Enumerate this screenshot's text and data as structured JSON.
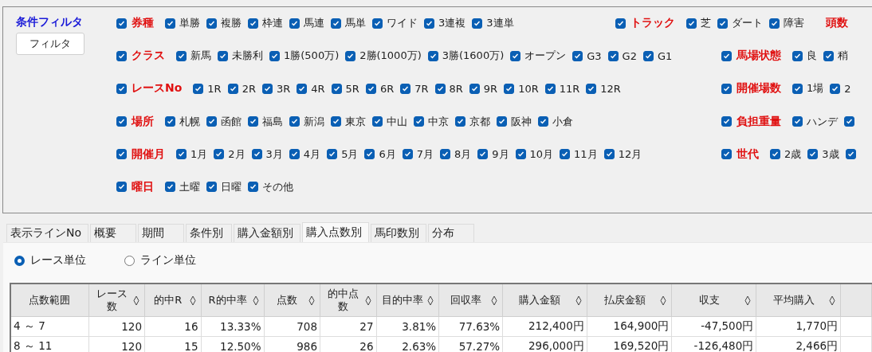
{
  "filter_panel": {
    "title": "条件フィルタ",
    "button": "フィルタ",
    "rows": [
      [
        {
          "label": "券種",
          "checked": true,
          "items": [
            {
              "label": "単勝",
              "checked": true
            },
            {
              "label": "複勝",
              "checked": true
            },
            {
              "label": "枠連",
              "checked": true
            },
            {
              "label": "馬連",
              "checked": true
            },
            {
              "label": "馬単",
              "checked": true
            },
            {
              "label": "ワイド",
              "checked": true
            },
            {
              "label": "3連複",
              "checked": true
            },
            {
              "label": "3連単",
              "checked": true
            }
          ]
        },
        {
          "label": "トラック",
          "checked": true,
          "items": [
            {
              "label": "芝",
              "checked": true
            },
            {
              "label": "ダート",
              "checked": true
            },
            {
              "label": "障害",
              "checked": true
            }
          ]
        },
        {
          "label": "頭数"
        }
      ],
      [
        {
          "label": "クラス",
          "checked": true,
          "items": [
            {
              "label": "新馬",
              "checked": true
            },
            {
              "label": "未勝利",
              "checked": true
            },
            {
              "label": "1勝(500万)",
              "checked": true
            },
            {
              "label": "2勝(1000万)",
              "checked": true
            },
            {
              "label": "3勝(1600万)",
              "checked": true
            },
            {
              "label": "オープン",
              "checked": true
            },
            {
              "label": "G3",
              "checked": true
            },
            {
              "label": "G2",
              "checked": true
            },
            {
              "label": "G1",
              "checked": true
            }
          ]
        },
        {
          "label": "馬場状態",
          "checked": true,
          "items": [
            {
              "label": "良",
              "checked": true
            },
            {
              "label": "稍",
              "checked": true
            }
          ]
        }
      ],
      [
        {
          "label": "レースNo",
          "checked": true,
          "items": [
            {
              "label": "1R",
              "checked": true
            },
            {
              "label": "2R",
              "checked": true
            },
            {
              "label": "3R",
              "checked": true
            },
            {
              "label": "4R",
              "checked": true
            },
            {
              "label": "5R",
              "checked": true
            },
            {
              "label": "6R",
              "checked": true
            },
            {
              "label": "7R",
              "checked": true
            },
            {
              "label": "8R",
              "checked": true
            },
            {
              "label": "9R",
              "checked": true
            },
            {
              "label": "10R",
              "checked": true
            },
            {
              "label": "11R",
              "checked": true
            },
            {
              "label": "12R",
              "checked": true
            }
          ]
        },
        {
          "label": "開催場数",
          "checked": true,
          "items": [
            {
              "label": "1場",
              "checked": true
            },
            {
              "label": "2",
              "checked": true
            }
          ]
        }
      ],
      [
        {
          "label": "場所",
          "checked": true,
          "items": [
            {
              "label": "札幌",
              "checked": true
            },
            {
              "label": "函館",
              "checked": true
            },
            {
              "label": "福島",
              "checked": true
            },
            {
              "label": "新潟",
              "checked": true
            },
            {
              "label": "東京",
              "checked": true
            },
            {
              "label": "中山",
              "checked": true
            },
            {
              "label": "中京",
              "checked": true
            },
            {
              "label": "京都",
              "checked": true
            },
            {
              "label": "阪神",
              "checked": true
            },
            {
              "label": "小倉",
              "checked": true
            }
          ]
        },
        {
          "label": "負担重量",
          "checked": true,
          "items": [
            {
              "label": "ハンデ",
              "checked": true
            },
            {
              "checked": true
            }
          ]
        }
      ],
      [
        {
          "label": "開催月",
          "checked": true,
          "items": [
            {
              "label": "1月",
              "checked": true
            },
            {
              "label": "2月",
              "checked": true
            },
            {
              "label": "3月",
              "checked": true
            },
            {
              "label": "4月",
              "checked": true
            },
            {
              "label": "5月",
              "checked": true
            },
            {
              "label": "6月",
              "checked": true
            },
            {
              "label": "7月",
              "checked": true
            },
            {
              "label": "8月",
              "checked": true
            },
            {
              "label": "9月",
              "checked": true
            },
            {
              "label": "10月",
              "checked": true
            },
            {
              "label": "11月",
              "checked": true
            },
            {
              "label": "12月",
              "checked": true
            }
          ]
        },
        {
          "label": "世代",
          "checked": true,
          "items": [
            {
              "label": "2歳",
              "checked": true
            },
            {
              "label": "3歳",
              "checked": true
            },
            {
              "checked": true
            }
          ]
        }
      ],
      [
        {
          "label": "曜日",
          "checked": true,
          "items": [
            {
              "label": "土曜",
              "checked": true
            },
            {
              "label": "日曜",
              "checked": true
            },
            {
              "label": "その他",
              "checked": true
            }
          ]
        }
      ]
    ]
  },
  "tabs": [
    {
      "label": "表示ラインNo",
      "selected": false
    },
    {
      "label": "概要",
      "selected": false
    },
    {
      "label": "期間",
      "selected": false
    },
    {
      "label": "条件別",
      "selected": false
    },
    {
      "label": "購入金額別",
      "selected": false
    },
    {
      "label": "購入点数別",
      "selected": true
    },
    {
      "label": "馬印数別",
      "selected": false
    },
    {
      "label": "分布",
      "selected": false
    }
  ],
  "unit_options": [
    {
      "label": "レース単位",
      "selected": true
    },
    {
      "label": "ライン単位",
      "selected": false
    }
  ],
  "table": {
    "columns": [
      {
        "label": "点数範囲",
        "sortable": false
      },
      {
        "label": "レース数",
        "sortable": true
      },
      {
        "label": "的中R",
        "sortable": true
      },
      {
        "label": "R的中率",
        "sortable": true
      },
      {
        "label": "点数",
        "sortable": true
      },
      {
        "label": "的中点数",
        "sortable": true
      },
      {
        "label": "目的中率",
        "sortable": true
      },
      {
        "label": "回収率",
        "sortable": true
      },
      {
        "label": "購入金額",
        "sortable": true
      },
      {
        "label": "払戻金額",
        "sortable": true
      },
      {
        "label": "収支",
        "sortable": true
      },
      {
        "label": "平均購入",
        "sortable": true
      },
      {
        "sortable": false
      }
    ],
    "rows": [
      [
        "4 ～ 7",
        "120",
        "16",
        "13.33%",
        "708",
        "27",
        "3.81%",
        "77.63%",
        "212,400円",
        "164,900円",
        "-47,500円",
        "1,770円"
      ],
      [
        "8 ～ 11",
        "120",
        "15",
        "12.50%",
        "986",
        "26",
        "2.63%",
        "57.27%",
        "296,000円",
        "169,520円",
        "-126,480円",
        "2,466円"
      ]
    ]
  }
}
